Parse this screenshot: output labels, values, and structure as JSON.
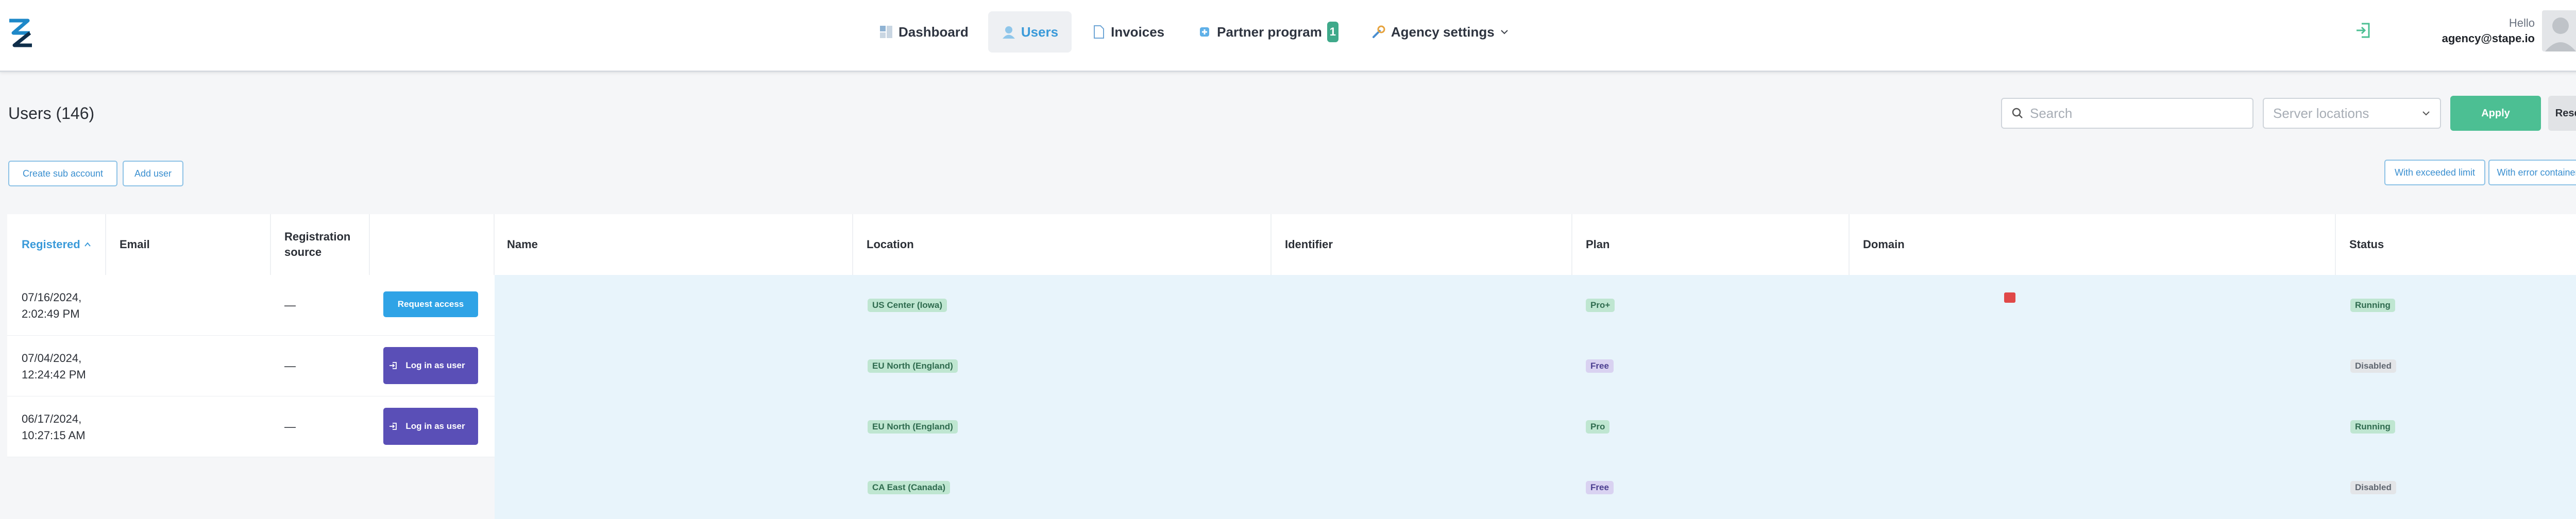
{
  "header": {
    "nav": [
      {
        "label": "Dashboard",
        "icon": "dashboard-icon"
      },
      {
        "label": "Users",
        "icon": "users-icon",
        "active": true
      },
      {
        "label": "Invoices",
        "icon": "invoice-icon"
      },
      {
        "label": "Partner program",
        "icon": "partner-icon",
        "badge": "1"
      },
      {
        "label": "Agency settings",
        "icon": "wrench-icon"
      }
    ],
    "hello": "Hello",
    "email": "agency@stape.io"
  },
  "toolbar": {
    "title": "Users  (146)",
    "search_placeholder": "Search",
    "location_placeholder": "Server locations",
    "apply": "Apply",
    "reset": "Reset",
    "create_sub_account": "Create sub account",
    "add_user": "Add user",
    "with_exceeded_limit": "With exceeded limit",
    "with_error_containers": "With error containers"
  },
  "table": {
    "columns": {
      "registered": "Registered",
      "email": "Email",
      "registration_source": "Registration source",
      "name": "Name",
      "location": "Location",
      "identifier": "Identifier",
      "plan": "Plan",
      "domain": "Domain",
      "status": "Status"
    },
    "left_rows": [
      {
        "date1": "07/16/2024,",
        "date2": "2:02:49 PM",
        "source": "—",
        "action": "Request access"
      },
      {
        "date1": "07/04/2024,",
        "date2": "12:24:42 PM",
        "source": "—",
        "action": "Log in as user"
      },
      {
        "date1": "06/17/2024,",
        "date2": "10:27:15 AM",
        "source": "—",
        "action": "Log in as user"
      }
    ],
    "right_rows": [
      {
        "location": "US Center (Iowa)",
        "plan": "Pro+",
        "status": "Running"
      },
      {
        "location": "EU North (England)",
        "plan": "Free",
        "status": "Disabled"
      },
      {
        "location": "EU North (England)",
        "plan": "Pro",
        "status": "Running"
      },
      {
        "location": "CA East (Canada)",
        "plan": "Free",
        "status": "Disabled"
      }
    ]
  },
  "colors": {
    "accent": "#3a9ad9",
    "apply_green": "#4cbf93",
    "login_purple": "#5a4fb7",
    "request_blue": "#2fa3e6",
    "row_highlight": "#e8f4fb"
  }
}
